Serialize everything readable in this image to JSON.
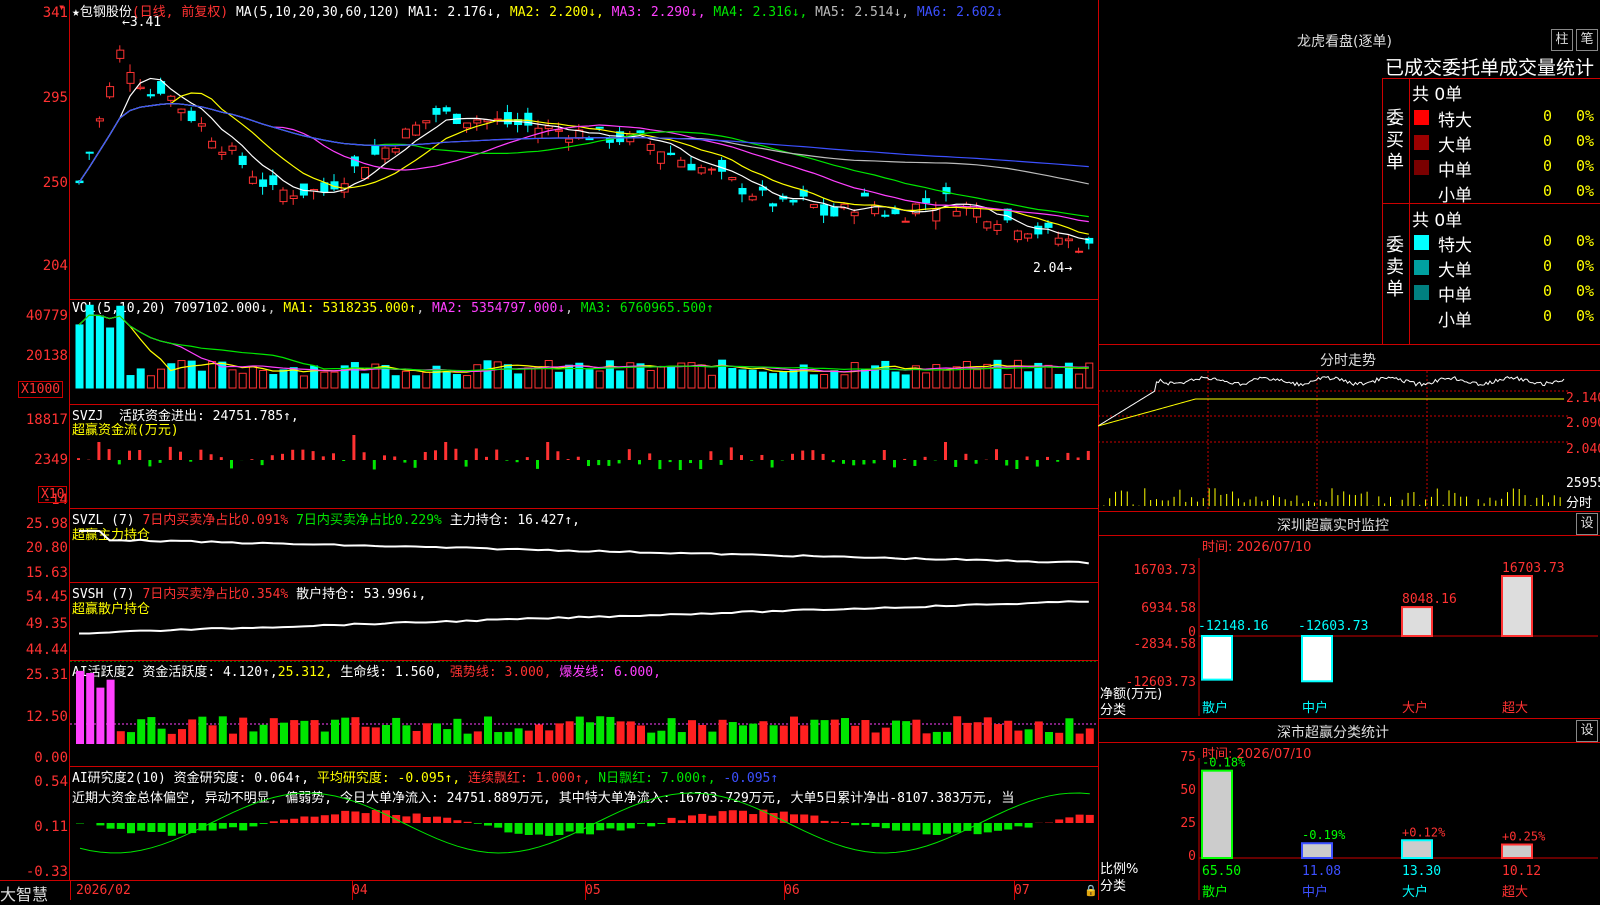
{
  "stock": {
    "marker": "★",
    "name": "包钢股份",
    "mode": "(日线, 前复权)"
  },
  "ma_header": {
    "label": "MA(5,10,20,30,60,120)",
    "items": [
      {
        "k": "MA1:",
        "v": "2.176↓",
        "c": "#fff"
      },
      {
        "k": "MA2:",
        "v": "2.200↓",
        "c": "#ffff00"
      },
      {
        "k": "MA3:",
        "v": "2.290↓",
        "c": "#ff40ff"
      },
      {
        "k": "MA4:",
        "v": "2.316↓",
        "c": "#00e600"
      },
      {
        "k": "MA5:",
        "v": "2.514↓",
        "c": "#bbb"
      },
      {
        "k": "MA6:",
        "v": "2.602↓",
        "c": "#3c50ff"
      }
    ]
  },
  "price_axis": [
    "341",
    "295",
    "250",
    "204"
  ],
  "price_marks": {
    "high": "3.41",
    "low": "2.04"
  },
  "vol_header": {
    "label": "VOL(5,10,20)",
    "v": "7097102.000↓",
    "ma1": "MA1: 5318235.000↑",
    "ma2": "MA2: 5354797.000↓",
    "ma3": "MA3: 6760965.500↑"
  },
  "vol_axis": [
    "40779",
    "20138"
  ],
  "vol_unit": "X1000",
  "svzj": {
    "label": "SVZJ",
    "desc": "活跃资金进出: 24751.785↑,",
    "sub": "超赢资金流(万元)",
    "axis": [
      "18817",
      "2349",
      "-14"
    ],
    "unit": "X10"
  },
  "svzl": {
    "label": "SVZL (7)",
    "a": "7日内买卖净占比0.091%",
    "b": "7日内买卖净占比0.229%",
    "c": "主力持仓: 16.427↑,",
    "sub": "超赢主力持仓",
    "axis": [
      "25.98",
      "20.80",
      "15.63"
    ]
  },
  "svsh": {
    "label": "SVSH (7)",
    "a": "7日内买卖净占比0.354%",
    "c": "散户持仓: 53.996↓,",
    "sub": "超赢散户持仓",
    "axis": [
      "54.45",
      "49.35",
      "44.44"
    ]
  },
  "ai1": {
    "label": "AI活跃度2",
    "a": "资金活跃度: 4.120↑,",
    "b": "25.312,",
    "c": "生命线: 1.560,",
    "d": "强势线: 3.000,",
    "e": "爆发线: 6.000,",
    "axis": [
      "25.31",
      "12.50",
      "0.00"
    ]
  },
  "ai2": {
    "label": "AI研究度2(10)",
    "a": "资金研究度: 0.064↑,",
    "b": "平均研究度: -0.095↑,",
    "c": "连续飘红: 1.000↑,",
    "d": "N日飘红: 7.000↑,",
    "e": "-0.095↑",
    "text": "近期大资金总体偏空, 异动不明显, 偏弱势, 今日大单净流入: 24751.889万元, 其中特大单净流入: 16703.729万元, 大单5日累计净出-8107.383万元, 当",
    "axis": [
      "0.54",
      "0.11",
      "-0.33"
    ]
  },
  "date_axis": [
    "2026/02",
    "04",
    "05",
    "06",
    "07"
  ],
  "brand": "大智慧",
  "right": {
    "dragon_title": "龙虎看盘(逐单)",
    "btn_a": "柱",
    "btn_b": "笔",
    "order_title": "已成交委托单成交量统计",
    "buy": {
      "side": "委买单",
      "total": "共 0单",
      "rows": [
        {
          "n": "特大",
          "v": "0",
          "p": "0%",
          "c": "#ff0000"
        },
        {
          "n": "大单",
          "v": "0",
          "p": "0%",
          "c": "#9b0000"
        },
        {
          "n": "中单",
          "v": "0",
          "p": "0%",
          "c": "#7a0000"
        },
        {
          "n": "小单",
          "v": "0",
          "p": "0%",
          "c": "#000"
        }
      ]
    },
    "sell": {
      "side": "委卖单",
      "total": "共 0单",
      "rows": [
        {
          "n": "特大",
          "v": "0",
          "p": "0%",
          "c": "#00ffff"
        },
        {
          "n": "大单",
          "v": "0",
          "p": "0%",
          "c": "#00a0a0"
        },
        {
          "n": "中单",
          "v": "0",
          "p": "0%",
          "c": "#008080"
        },
        {
          "n": "小单",
          "v": "0",
          "p": "0%",
          "c": "#000"
        }
      ]
    },
    "intraday_title": "分时走势",
    "intraday_axis": [
      "2.140",
      "2.090",
      "2.040"
    ],
    "intraday_vol": "25955",
    "intraday_unit": "分时",
    "sz_title": "深圳超赢实时监控",
    "sz_date": "时间: 2026/07/10",
    "btn_set": "设",
    "sz_axis": [
      "16703.73",
      "6934.58",
      "0",
      "-2834.58",
      "-12603.73"
    ],
    "sz_net": "净额(万元)",
    "sz_cat": "分类",
    "sz_bars": [
      {
        "name": "散户",
        "value": -12148.16
      },
      {
        "name": "中户",
        "value": -12603.73
      },
      {
        "name": "大户",
        "value": 8048.16
      },
      {
        "name": "超大",
        "value": 16703.73
      }
    ],
    "sz_labels": [
      "-12148.16",
      "-12603.73",
      "8048.16",
      "16703.73"
    ],
    "stat_title": "深市超赢分类统计",
    "stat_date": "时间: 2026/07/10",
    "stat_axis": [
      "75",
      "50",
      "25",
      "0"
    ],
    "stat_ratio": "比例%",
    "stat_cat": "分类",
    "stat_bars": [
      {
        "name": "散户",
        "value": 65.5,
        "delta": "-0.18%"
      },
      {
        "name": "中户",
        "value": 11.08,
        "delta": "-0.19%"
      },
      {
        "name": "大户",
        "value": 13.3,
        "delta": "+0.12%"
      },
      {
        "name": "超大",
        "value": 10.12,
        "delta": "+0.25%"
      }
    ],
    "stat_values": [
      "65.50",
      "11.08",
      "13.30",
      "10.12"
    ]
  }
}
